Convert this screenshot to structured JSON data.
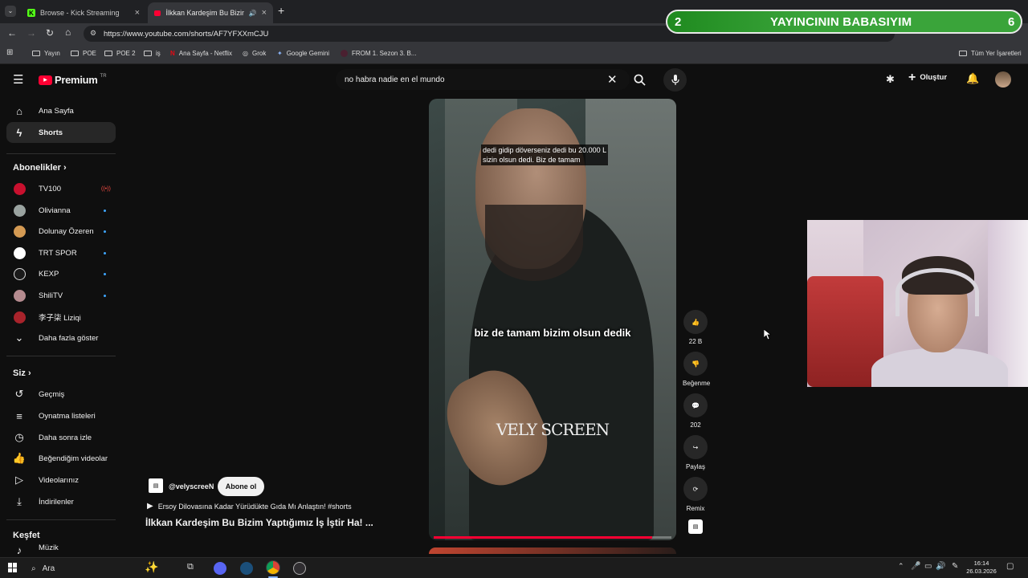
{
  "browser": {
    "tabs": [
      {
        "label": "Browse - Kick Streaming",
        "icon": "kick-icon"
      },
      {
        "label": "İlkkan Kardeşim Bu Bizim Ya",
        "icon": "youtube-icon"
      }
    ],
    "url": "https://www.youtube.com/shorts/AF7YFXXmCJU",
    "bookmarks": [
      "Yayın",
      "POE",
      "POE 2",
      "iş",
      "Ana Sayfa - Netflix",
      "Grok",
      "Google Gemini",
      "FROM 1. Sezon 3. B..."
    ],
    "all_bookmarks": "Tüm Yer İşaretleri"
  },
  "overlay": {
    "left_num": "2",
    "title": "YAYINCININ BABASIYIM",
    "right_num": "6"
  },
  "youtube": {
    "logo": "Premium",
    "logo_sup": "TR",
    "search_value": "no habra nadie en el mundo",
    "create_label": "Oluştur",
    "sidebar": {
      "home": "Ana Sayfa",
      "shorts": "Shorts",
      "subs_header": "Abonelikler",
      "channels": [
        "TV100",
        "Olivianna",
        "Dolunay Özeren",
        "TRT SPOR",
        "KEXP",
        "ShiliTV",
        "李子柒 Liziqi"
      ],
      "show_more": "Daha fazla göster",
      "you_header": "Siz",
      "you_items": [
        "Geçmiş",
        "Oynatma listeleri",
        "Daha sonra izle",
        "Beğendiğim videolar",
        "Videolarınız",
        "İndirilenler"
      ],
      "explore_header": "Keşfet",
      "explore_items": [
        "Müzik"
      ]
    },
    "short": {
      "caption_top_1": "dedi gidip döverseniz dedi bu 20.000 L",
      "caption_top_2": "sizin olsun dedi. Biz de tamam",
      "caption_mid": "biz de tamam bizim olsun dedik",
      "watermark": "VELY SCREEN",
      "channel": "@velyscreeN",
      "subscribe": "Abone ol",
      "playlist": "Ersoy Dilovasına Kadar Yürüdükte Gıda Mı Anlaştın! #shorts",
      "title": "İlkkan Kardeşim Bu Bizim Yaptığımız İş İştir Ha! ...",
      "progress": 0.92
    },
    "actions": {
      "likes": "22 B",
      "dislike": "Beğenme",
      "comments": "202",
      "share": "Paylaş",
      "remix": "Remix"
    }
  },
  "taskbar": {
    "search": "Ara",
    "time": "16:14",
    "date": "26.03.2026"
  },
  "colors": {
    "accent_red": "#ff0033",
    "overlay_green": "#3aa43a",
    "subs_dot": "#3ea6ff"
  }
}
